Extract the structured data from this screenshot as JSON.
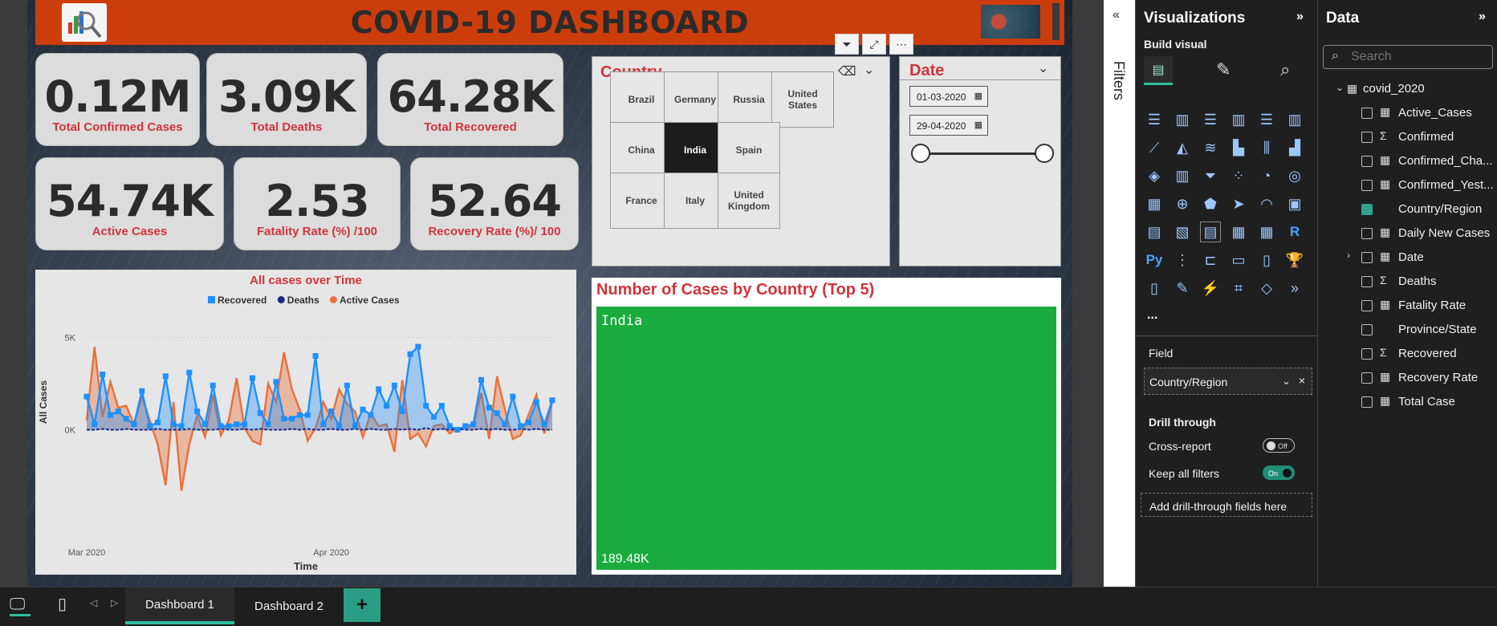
{
  "dashboard": {
    "title": "COVID-19 DASHBOARD",
    "kpis": [
      {
        "value": "0.12M",
        "label": "Total Confirmed Cases"
      },
      {
        "value": "3.09K",
        "label": "Total Deaths"
      },
      {
        "value": "64.28K",
        "label": "Total Recovered"
      },
      {
        "value": "54.74K",
        "label": "Active Cases"
      },
      {
        "value": "2.53",
        "label": "Fatality Rate (%) /100"
      },
      {
        "value": "52.64",
        "label": "Recovery Rate (%)/ 100"
      }
    ],
    "country_slicer": {
      "title": "Country",
      "countries": [
        "Brazil",
        "Germany",
        "Russia",
        "United States",
        "China",
        "India",
        "Spain",
        "France",
        "Italy",
        "United Kingdom"
      ],
      "selected": "India"
    },
    "date_slicer": {
      "title": "Date",
      "start": "01-03-2020",
      "end": "29-04-2020"
    },
    "treemap": {
      "title": "Number of Cases by Country (Top 5)",
      "country": "India",
      "value_label": "189.48K",
      "color": "#1aab3e"
    }
  },
  "chart_data": {
    "type": "area",
    "title": "All cases over Time",
    "xlabel": "Time",
    "ylabel": "All Cases",
    "yticks": [
      "5K",
      "0K"
    ],
    "xticks": [
      "Mar 2020",
      "Apr 2020"
    ],
    "ylim": [
      -3500,
      6500
    ],
    "x": [
      "2020-03-01",
      "2020-03-02",
      "2020-03-03",
      "2020-03-04",
      "2020-03-05",
      "2020-03-06",
      "2020-03-07",
      "2020-03-08",
      "2020-03-09",
      "2020-03-10",
      "2020-03-11",
      "2020-03-12",
      "2020-03-13",
      "2020-03-14",
      "2020-03-15",
      "2020-03-16",
      "2020-03-17",
      "2020-03-18",
      "2020-03-19",
      "2020-03-20",
      "2020-03-21",
      "2020-03-22",
      "2020-03-23",
      "2020-03-24",
      "2020-03-25",
      "2020-03-26",
      "2020-03-27",
      "2020-03-28",
      "2020-03-29",
      "2020-03-30",
      "2020-03-31",
      "2020-04-01",
      "2020-04-02",
      "2020-04-03",
      "2020-04-04",
      "2020-04-05",
      "2020-04-06",
      "2020-04-07",
      "2020-04-08",
      "2020-04-09",
      "2020-04-10",
      "2020-04-11",
      "2020-04-12",
      "2020-04-13",
      "2020-04-14",
      "2020-04-15",
      "2020-04-16",
      "2020-04-17",
      "2020-04-18",
      "2020-04-19",
      "2020-04-20",
      "2020-04-21",
      "2020-04-22",
      "2020-04-23",
      "2020-04-24",
      "2020-04-25",
      "2020-04-26",
      "2020-04-27",
      "2020-04-28",
      "2020-04-29"
    ],
    "series": [
      {
        "name": "Recovered",
        "color": "#1e90ff",
        "values": [
          1800,
          300,
          3000,
          800,
          1000,
          600,
          300,
          2100,
          200,
          400,
          2900,
          300,
          200,
          3100,
          1000,
          300,
          2400,
          200,
          200,
          300,
          300,
          2800,
          900,
          300,
          2600,
          600,
          600,
          800,
          800,
          4000,
          300,
          1000,
          200,
          2400,
          200,
          1100,
          800,
          2200,
          1300,
          2400,
          1000,
          4100,
          4500,
          1300,
          700,
          1300,
          200,
          0,
          200,
          300,
          2700,
          1200,
          900,
          300,
          1800,
          200,
          400,
          1500,
          300,
          1600
        ]
      },
      {
        "name": "Deaths",
        "color": "#1a2a8a",
        "values": [
          0,
          0,
          50,
          0,
          0,
          50,
          0,
          0,
          0,
          50,
          0,
          0,
          0,
          50,
          0,
          0,
          0,
          50,
          0,
          0,
          50,
          0,
          50,
          0,
          0,
          0,
          50,
          0,
          50,
          0,
          0,
          50,
          0,
          0,
          50,
          0,
          50,
          0,
          0,
          50,
          0,
          50,
          0,
          100,
          0,
          50,
          0,
          50,
          0,
          0,
          50,
          0,
          50,
          0,
          0,
          50,
          0,
          50,
          0,
          0
        ]
      },
      {
        "name": "Active Cases",
        "color": "#e8703a",
        "values": [
          500,
          4500,
          700,
          2600,
          1200,
          1300,
          300,
          1800,
          500,
          -800,
          -3000,
          1500,
          -3300,
          -800,
          800,
          -400,
          1900,
          -300,
          500,
          2800,
          100,
          -600,
          -800,
          2500,
          1500,
          4200,
          2200,
          1100,
          -600,
          100,
          1500,
          600,
          2200,
          1400,
          1000,
          -400,
          900,
          200,
          300,
          -1200,
          2700,
          -500,
          -200,
          -900,
          200,
          300,
          -200,
          100,
          100,
          200,
          2000,
          -500,
          2900,
          1100,
          -500,
          -300,
          800,
          1900,
          -200,
          1500
        ]
      }
    ]
  },
  "visualizations_pane": {
    "title": "Visualizations",
    "build_visual": "Build visual",
    "more": "...",
    "field_section": "Field",
    "field_value": "Country/Region",
    "drill_through": "Drill through",
    "cross_report": "Cross-report",
    "cross_report_state": "Off",
    "keep_all_filters": "Keep all filters",
    "keep_all_filters_state": "On",
    "add_drill": "Add drill-through fields here",
    "icons": [
      "stacked-bar",
      "clustered-column",
      "clustered-bar",
      "stacked-column",
      "100-bar",
      "100-column",
      "line",
      "area",
      "stacked-area",
      "line-clustered",
      "ribbon",
      "waterfall",
      "scatter-funnel",
      "waterfall-2",
      "funnel",
      "scatter",
      "pie",
      "donut",
      "treemap",
      "map",
      "filled-map",
      "azure-map",
      "gauge",
      "card",
      "multi-row-card",
      "kpi",
      "slicer",
      "table",
      "matrix",
      "r-visual",
      "python-visual",
      "key-influencers",
      "decomposition-tree",
      "qa",
      "smart-narrative",
      "paginated",
      "metrics",
      "power-apps",
      "power-automate",
      "on-object",
      "diamond",
      "chevron"
    ]
  },
  "data_pane": {
    "title": "Data",
    "search_placeholder": "Search",
    "table": "covid_2020",
    "fields": [
      {
        "name": "Active_Cases",
        "icon": "calc",
        "checked": false
      },
      {
        "name": "Confirmed",
        "icon": "sigma",
        "checked": false
      },
      {
        "name": "Confirmed_Cha...",
        "icon": "calc",
        "checked": false
      },
      {
        "name": "Confirmed_Yest...",
        "icon": "calc",
        "checked": false
      },
      {
        "name": "Country/Region",
        "icon": "none",
        "checked": true
      },
      {
        "name": "Daily New Cases",
        "icon": "calc",
        "checked": false
      },
      {
        "name": "Date",
        "icon": "table",
        "checked": false,
        "expand": true
      },
      {
        "name": "Deaths",
        "icon": "sigma",
        "checked": false
      },
      {
        "name": "Fatality Rate",
        "icon": "calc",
        "checked": false
      },
      {
        "name": "Province/State",
        "icon": "none",
        "checked": false
      },
      {
        "name": "Recovered",
        "icon": "sigma",
        "checked": false
      },
      {
        "name": "Recovery Rate",
        "icon": "calc",
        "checked": false
      },
      {
        "name": "Total Case",
        "icon": "calc",
        "checked": false
      }
    ]
  },
  "filters_pane": {
    "label": "Filters"
  },
  "bottom_bar": {
    "pages": [
      "Dashboard 1",
      "Dashboard 2"
    ],
    "active_page": "Dashboard 1",
    "add_page": "+"
  }
}
